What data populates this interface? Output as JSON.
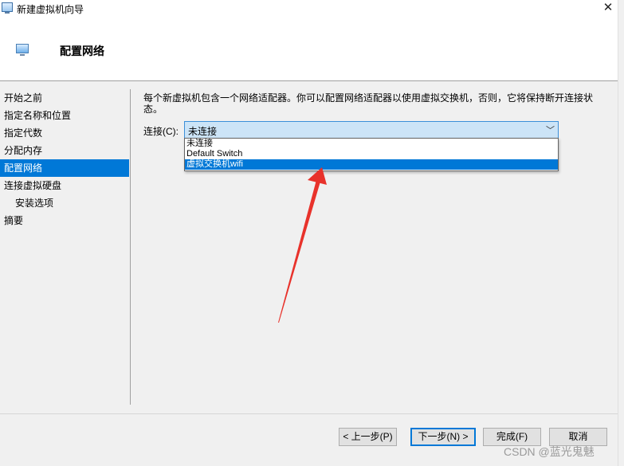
{
  "window": {
    "title": "新建虚拟机向导",
    "close_glyph": "✕"
  },
  "header": {
    "title": "配置网络"
  },
  "nav": {
    "items": [
      {
        "label": "开始之前"
      },
      {
        "label": "指定名称和位置"
      },
      {
        "label": "指定代数"
      },
      {
        "label": "分配内存"
      },
      {
        "label": "配置网络"
      },
      {
        "label": "连接虚拟硬盘"
      },
      {
        "label": "安装选项"
      },
      {
        "label": "摘要"
      }
    ]
  },
  "content": {
    "description_line1": "每个新虚拟机包含一个网络适配器。你可以配置网络适配器以使用虚拟交换机，否则，它将保持断开连接状",
    "description_line2": "态。",
    "connection_label": "连接(C):",
    "connection_value": "未连接",
    "options": [
      "未连接",
      "Default Switch",
      "虚拟交换机wifi"
    ]
  },
  "buttons": {
    "prev": "< 上一步(P)",
    "next": "下一步(N) >",
    "finish": "完成(F)",
    "cancel": "取消"
  },
  "watermark": "CSDN @蓝光鬼魅",
  "colors": {
    "accent": "#0078d7",
    "arrow": "#e8322b",
    "combo_bg": "#cce4f7"
  }
}
